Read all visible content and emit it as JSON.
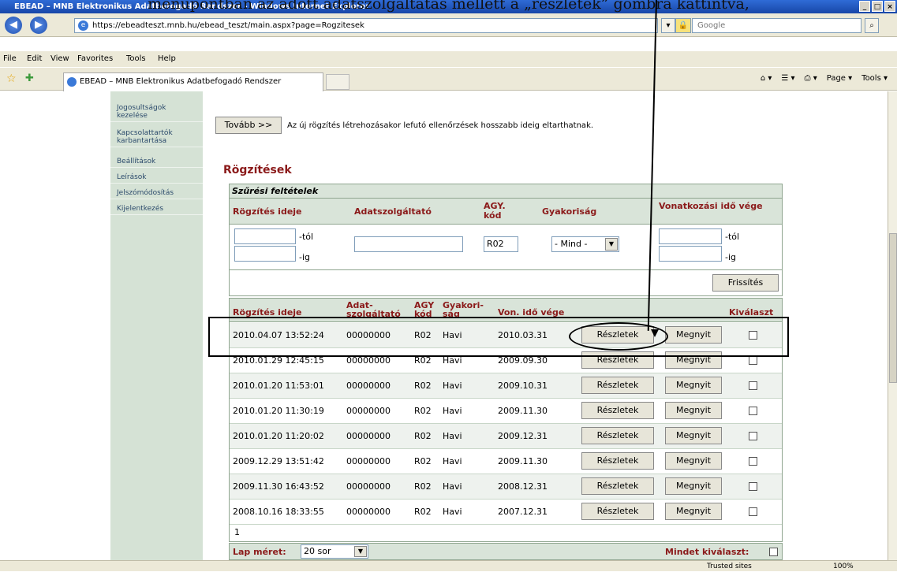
{
  "doc_caption": "menüpontban az adott adatszolgáltatás mellett a „részletek” gombra kattintva,",
  "window": {
    "title": "EBEAD – MNB Elektronikus Adatbefogadó Rendszer - Windows Internet Explorer",
    "min": "_",
    "max": "□",
    "close": "×"
  },
  "nav": {
    "back": "◀",
    "forward": "▶",
    "address": "https://ebeadteszt.mnb.hu/ebead_teszt/main.aspx?page=Rogzitesek",
    "search_placeholder": "Google",
    "dropdown": "▾",
    "lock": "🔒",
    "refresh": "↻",
    "stop": "✕",
    "go": "⌕"
  },
  "menu": {
    "file": "File",
    "edit": "Edit",
    "view": "View",
    "favorites": "Favorites",
    "tools": "Tools",
    "help": "Help"
  },
  "favbar": {
    "tab_title": "EBEAD – MNB Elektronikus Adatbefogadó Rendszer",
    "home": "⌂ ▾",
    "feeds": "☰ ▾",
    "print": "⎙ ▾",
    "page": "Page ▾",
    "tools": "Tools ▾",
    "star": "☆",
    "add": "✚"
  },
  "sidebar": {
    "items": [
      "Jogosultságok kezelése",
      "Kapcsolattartók karbantartása",
      "Beállítások",
      "Leírások",
      "Jelszómódosítás",
      "Kijelentkezés"
    ]
  },
  "main": {
    "continue_button": "Tovább >>",
    "continue_note": "Az új rögzítés létrehozásakor lefutó ellenőrzések hosszabb ideig eltarthatnak.",
    "section_title": "Rögzítések",
    "filter": {
      "caption": "Szűrési feltételek",
      "headers": {
        "rec_time": "Rögzítés ideje",
        "provider": "Adatszolgáltató",
        "agy": "AGY. kód",
        "freq": "Gyakoriság",
        "ref_end": "Vonatkozási idő vége"
      },
      "from_label": "-tól",
      "to_label": "-ig",
      "agy_value": "R02",
      "freq_value": "- Mind -",
      "refresh_button": "Frissítés"
    },
    "results": {
      "headers": {
        "rec_time": "Rögzítés ideje",
        "provider": "Adat-szolgáltató",
        "agy": "AGY kód",
        "freq": "Gyakori-ság",
        "ref_end": "Von. idő vége",
        "select": "Kiválaszt"
      },
      "rows": [
        {
          "time": "2010.04.07 13:52:24",
          "provider": "00000000",
          "agy": "R02",
          "freq": "Havi",
          "end": "2010.03.31"
        },
        {
          "time": "2010.01.29 12:45:15",
          "provider": "00000000",
          "agy": "R02",
          "freq": "Havi",
          "end": "2009.09.30"
        },
        {
          "time": "2010.01.20 11:53:01",
          "provider": "00000000",
          "agy": "R02",
          "freq": "Havi",
          "end": "2009.10.31"
        },
        {
          "time": "2010.01.20 11:30:19",
          "provider": "00000000",
          "agy": "R02",
          "freq": "Havi",
          "end": "2009.11.30"
        },
        {
          "time": "2010.01.20 11:20:02",
          "provider": "00000000",
          "agy": "R02",
          "freq": "Havi",
          "end": "2009.12.31"
        },
        {
          "time": "2009.12.29 13:51:42",
          "provider": "00000000",
          "agy": "R02",
          "freq": "Havi",
          "end": "2009.11.30"
        },
        {
          "time": "2009.11.30 16:43:52",
          "provider": "00000000",
          "agy": "R02",
          "freq": "Havi",
          "end": "2008.12.31"
        },
        {
          "time": "2008.10.16 18:33:55",
          "provider": "00000000",
          "agy": "R02",
          "freq": "Havi",
          "end": "2007.12.31"
        }
      ],
      "details_label": "Részletek",
      "open_label": "Megnyit",
      "page_number": "1"
    },
    "footer": {
      "page_size_label": "Lap méret:",
      "page_size_value": "20 sor",
      "select_all_label": "Mindet kiválaszt:"
    }
  },
  "status": {
    "zone": "Trusted sites",
    "zoom": "100%"
  }
}
